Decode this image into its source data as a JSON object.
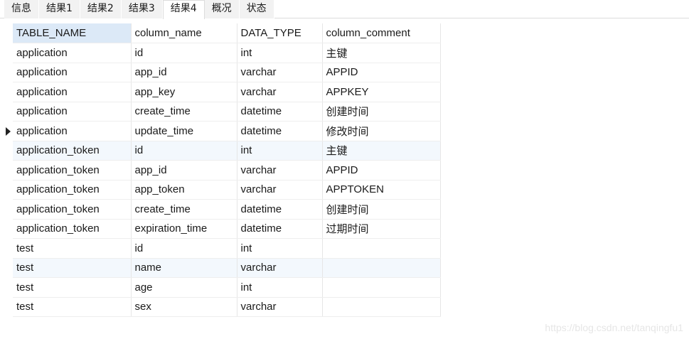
{
  "tabs": [
    {
      "label": "信息",
      "active": false
    },
    {
      "label": "结果1",
      "active": false
    },
    {
      "label": "结果2",
      "active": false
    },
    {
      "label": "结果3",
      "active": false
    },
    {
      "label": "结果4",
      "active": true
    },
    {
      "label": "概况",
      "active": false
    },
    {
      "label": "状态",
      "active": false
    }
  ],
  "grid": {
    "columns": [
      "TABLE_NAME",
      "column_name",
      "DATA_TYPE",
      "column_comment"
    ],
    "sorted_column": "TABLE_NAME",
    "current_row_index": 4,
    "rows": [
      [
        "application",
        "id",
        "int",
        "主键"
      ],
      [
        "application",
        "app_id",
        "varchar",
        "APPID"
      ],
      [
        "application",
        "app_key",
        "varchar",
        "APPKEY"
      ],
      [
        "application",
        "create_time",
        "datetime",
        "创建时间"
      ],
      [
        "application",
        "update_time",
        "datetime",
        "修改时间"
      ],
      [
        "application_token",
        "id",
        "int",
        "主键"
      ],
      [
        "application_token",
        "app_id",
        "varchar",
        "APPID"
      ],
      [
        "application_token",
        "app_token",
        "varchar",
        "APPTOKEN"
      ],
      [
        "application_token",
        "create_time",
        "datetime",
        "创建时间"
      ],
      [
        "application_token",
        "expiration_time",
        "datetime",
        "过期时间"
      ],
      [
        "test",
        "id",
        "int",
        ""
      ],
      [
        "test",
        "name",
        "varchar",
        ""
      ],
      [
        "test",
        "age",
        "int",
        ""
      ],
      [
        "test",
        "sex",
        "varchar",
        ""
      ]
    ]
  },
  "watermark": "https://blog.csdn.net/tanqingfu1",
  "colors": {
    "header_sorted_bg": "#dce9f7",
    "alt_row_bg": "#f3f8fd",
    "inactive_tab_bg": "#f2f2f2"
  }
}
